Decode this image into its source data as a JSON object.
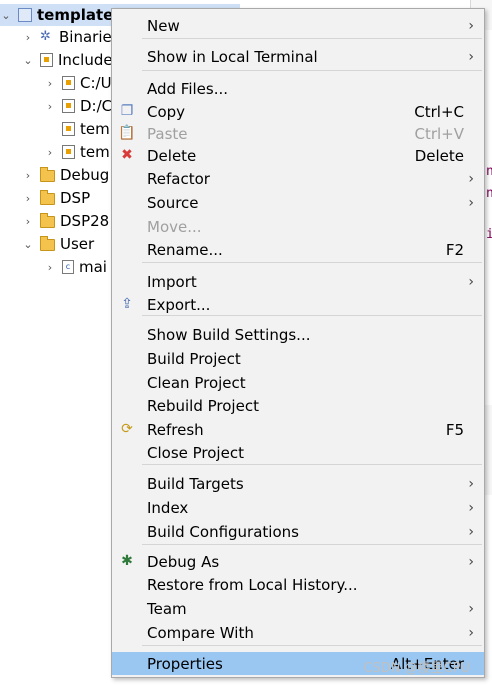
{
  "tree": {
    "project": "template",
    "items": [
      {
        "label": "Binarie",
        "level": 1,
        "icon": "binaries-icon"
      },
      {
        "label": "Include",
        "level": 1,
        "icon": "includes-icon"
      },
      {
        "label": "C:/U",
        "level": 2,
        "icon": "include-folder-icon"
      },
      {
        "label": "D:/C",
        "level": 2,
        "icon": "include-folder-icon"
      },
      {
        "label": "tem",
        "level": 2,
        "icon": "include-folder-icon"
      },
      {
        "label": "tem",
        "level": 2,
        "icon": "include-folder-icon"
      },
      {
        "label": "Debug",
        "level": 1,
        "icon": "folder-icon"
      },
      {
        "label": "DSP",
        "level": 1,
        "icon": "folder-icon"
      },
      {
        "label": "DSP28",
        "level": 1,
        "icon": "folder-icon"
      },
      {
        "label": "User",
        "level": 1,
        "icon": "folder-icon"
      },
      {
        "label": "mai",
        "level": 2,
        "icon": "c-file-icon"
      }
    ]
  },
  "menu": {
    "items": [
      {
        "label": "New",
        "submenu": true
      },
      {
        "label": "Show in Local Terminal",
        "submenu": true
      },
      {
        "label": "Add Files..."
      },
      {
        "label": "Copy",
        "shortcut": "Ctrl+C",
        "icon": "copy-icon"
      },
      {
        "label": "Paste",
        "shortcut": "Ctrl+V",
        "icon": "paste-icon",
        "disabled": true
      },
      {
        "label": "Delete",
        "shortcut": "Delete",
        "icon": "delete-icon"
      },
      {
        "label": "Refactor",
        "submenu": true
      },
      {
        "label": "Source",
        "submenu": true
      },
      {
        "label": "Move...",
        "disabled": true
      },
      {
        "label": "Rename...",
        "shortcut": "F2"
      },
      {
        "label": "Import",
        "submenu": true
      },
      {
        "label": "Export...",
        "icon": "export-icon"
      },
      {
        "label": "Show Build Settings..."
      },
      {
        "label": "Build Project"
      },
      {
        "label": "Clean Project"
      },
      {
        "label": "Rebuild Project"
      },
      {
        "label": "Refresh",
        "shortcut": "F5",
        "icon": "refresh-icon"
      },
      {
        "label": "Close Project"
      },
      {
        "label": "Build Targets",
        "submenu": true
      },
      {
        "label": "Index",
        "submenu": true
      },
      {
        "label": "Build Configurations",
        "submenu": true
      },
      {
        "label": "Debug As",
        "submenu": true,
        "icon": "debug-icon"
      },
      {
        "label": "Restore from Local History..."
      },
      {
        "label": "Team",
        "submenu": true
      },
      {
        "label": "Compare With",
        "submenu": true
      },
      {
        "label": "Properties",
        "shortcut": "Alt+Enter",
        "highlighted": true
      }
    ]
  },
  "watermark": "CSDN @楼里CPU",
  "colors": {
    "highlight": "#99c7f2",
    "menu_bg": "#f2f2f2",
    "selection": "#cfe0f6"
  }
}
